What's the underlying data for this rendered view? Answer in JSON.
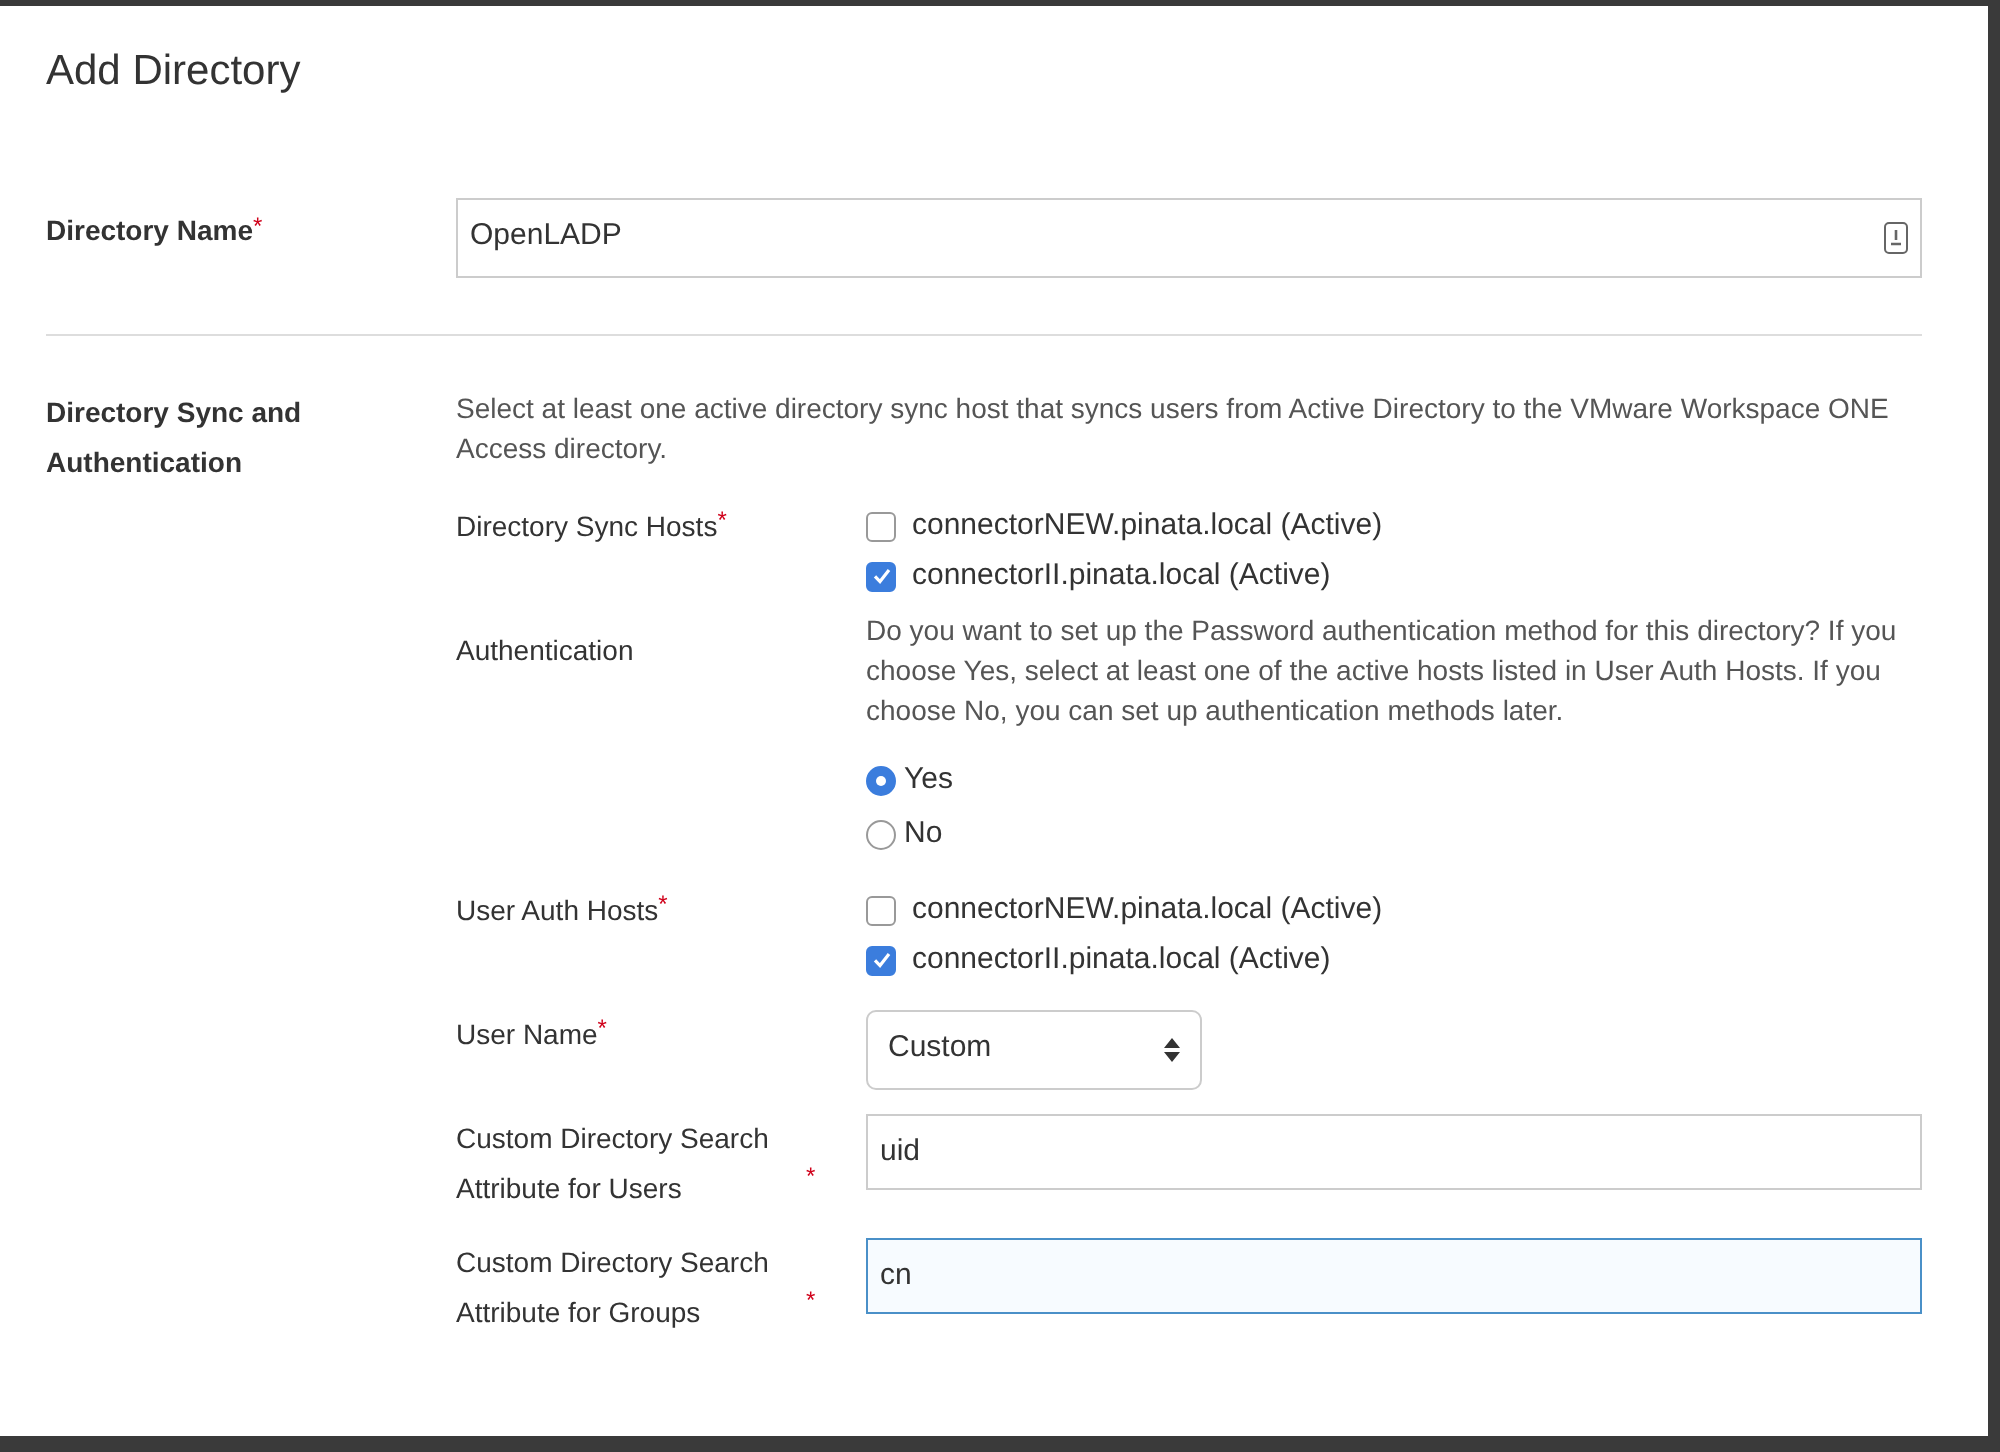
{
  "title": "Add Directory",
  "directory_name": {
    "label": "Directory Name",
    "mark": "*",
    "value": "OpenLADP"
  },
  "sync_section": {
    "label": "Directory Sync and Authentication",
    "description": "Select at least one active directory sync host that syncs users from Active Directory to the VMware Workspace ONE Access directory.",
    "fields": [
      {
        "kind": "checkboxes",
        "label": "Directory Sync Hosts",
        "mark": "*",
        "options": [
          {
            "label": "connectorNEW.pinata.local (Active)",
            "checked": false
          },
          {
            "label": "connectorII.pinata.local (Active)",
            "checked": true
          }
        ]
      },
      {
        "kind": "radios",
        "label": "Authentication",
        "description": "Do you want to set up the Password authentication method for this directory? If you choose Yes, select at least one of the active hosts listed in User Auth Hosts. If you choose No, you can set up authentication methods later.",
        "options": [
          {
            "label": "Yes",
            "selected": true
          },
          {
            "label": "No",
            "selected": false
          }
        ]
      },
      {
        "kind": "checkboxes",
        "label": "User Auth Hosts",
        "mark": "*",
        "options": [
          {
            "label": "connectorNEW.pinata.local (Active)",
            "checked": false
          },
          {
            "label": "connectorII.pinata.local (Active)",
            "checked": true
          }
        ]
      },
      {
        "kind": "select",
        "label": "User Name",
        "mark": "*",
        "value": "Custom"
      },
      {
        "kind": "text",
        "label": "Custom Directory Search Attribute for Users",
        "mark": "*",
        "value": "uid",
        "focused": false
      },
      {
        "kind": "text",
        "label": "Custom Directory Search Attribute for Groups",
        "mark": "*",
        "value": "cn",
        "focused": true
      }
    ]
  }
}
